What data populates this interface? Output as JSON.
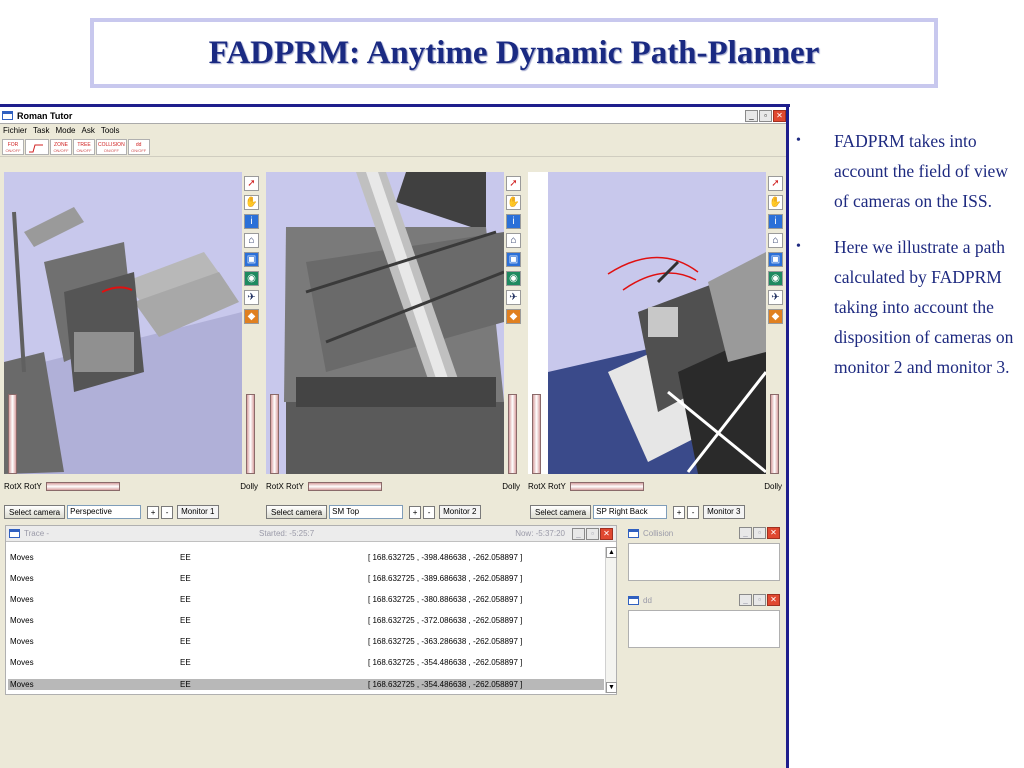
{
  "slide": {
    "title": "FADPRM: Anytime Dynamic Path-Planner",
    "bullets": [
      "FADPRM takes into account the field of view of cameras on the ISS.",
      "Here we illustrate a path calculated by FADPRM taking into account the disposition of cameras on monitor 2 and monitor 3."
    ]
  },
  "window": {
    "title": "Roman Tutor",
    "menu": [
      "Fichier",
      "Task",
      "Mode",
      "Ask",
      "Tools"
    ],
    "toolbar": [
      {
        "label": "FOR",
        "sub": "ON/OFF"
      },
      {
        "label": "2",
        "sub": ""
      },
      {
        "label": "ZONE",
        "sub": "ON/OFF"
      },
      {
        "label": "TREE",
        "sub": "ON/OFF"
      },
      {
        "label": "COLLISION",
        "sub": "ON/OFF"
      },
      {
        "label": "dd",
        "sub": "ON/OFF"
      }
    ]
  },
  "viewports": [
    {
      "rot_label": "RotX RotY",
      "dolly_label": "Dolly",
      "select_camera": "Select camera",
      "camera": "Perspective",
      "plus": "+",
      "minus": "-",
      "monitor": "Monitor 1"
    },
    {
      "rot_label": "RotX RotY",
      "dolly_label": "Dolly",
      "select_camera": "Select camera",
      "camera": "SM Top",
      "plus": "+",
      "minus": "-",
      "monitor": "Monitor 2"
    },
    {
      "rot_label": "RotX RotY",
      "dolly_label": "Dolly",
      "select_camera": "Select camera",
      "camera": "SP Right Back",
      "plus": "+",
      "minus": "-",
      "monitor": "Monitor 3"
    }
  ],
  "trace": {
    "title": "Trace -",
    "started": "Started: -5:25:7",
    "now": "Now: -5:37:20",
    "rows": [
      {
        "type": "Moves",
        "target": "EE",
        "coords": "[ 168.632725 , -398.486638 , -262.058897 ]"
      },
      {
        "type": "Moves",
        "target": "EE",
        "coords": "[ 168.632725 , -389.686638 , -262.058897 ]"
      },
      {
        "type": "Moves",
        "target": "EE",
        "coords": "[ 168.632725 , -380.886638 , -262.058897 ]"
      },
      {
        "type": "Moves",
        "target": "EE",
        "coords": "[ 168.632725 , -372.086638 , -262.058897 ]"
      },
      {
        "type": "Moves",
        "target": "EE",
        "coords": "[ 168.632725 , -363.286638 , -262.058897 ]"
      },
      {
        "type": "Moves",
        "target": "EE",
        "coords": "[ 168.632725 , -354.486638 , -262.058897 ]"
      },
      {
        "type": "Moves",
        "target": "EE",
        "coords": "[ 168.632725 , -354.486638 , -262.058897 ]"
      }
    ]
  },
  "collision_panel": {
    "title": "Collision"
  },
  "dd_panel": {
    "title": "dd"
  }
}
